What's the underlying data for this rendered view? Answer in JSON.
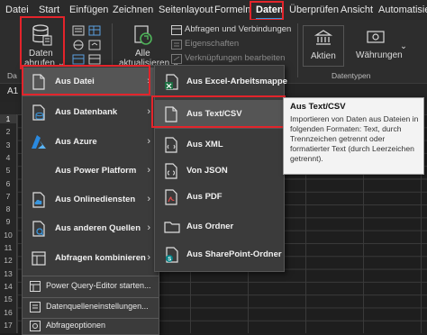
{
  "menubar": {
    "tabs": [
      "Datei",
      "Start",
      "Einfügen",
      "Zeichnen",
      "Seitenlayout",
      "Formeln",
      "Daten",
      "Überprüfen",
      "Ansicht",
      "Automatisie"
    ],
    "active_tab": "Daten"
  },
  "ribbon": {
    "get_data": {
      "line1": "Daten",
      "line2": "abrufen ⌄"
    },
    "refresh": {
      "line1": "Alle",
      "line2": "aktualisieren ⌄"
    },
    "queries_connections": "Abfragen und Verbindungen",
    "properties": "Eigenschaften",
    "edit_links": "Verknüpfungen bearbeiten",
    "stocks": "Aktien",
    "currencies": "Währungen",
    "group_datatypes": "Datentypen",
    "group_left_cut": "Da"
  },
  "formula_bar": {
    "name_box": "A1"
  },
  "rows": [
    "1",
    "2",
    "3",
    "4",
    "5",
    "6",
    "7",
    "8",
    "9",
    "10",
    "11",
    "12",
    "13",
    "14",
    "15",
    "16",
    "17"
  ],
  "menu_get_data": {
    "items": [
      {
        "label": "Aus Datei",
        "icon": "file-icon",
        "submenu": true
      },
      {
        "label": "Aus Datenbank",
        "icon": "database-icon",
        "submenu": true
      },
      {
        "label": "Aus Azure",
        "icon": "azure-icon",
        "submenu": true
      },
      {
        "label": "Aus Power Platform",
        "icon": "",
        "submenu": true
      },
      {
        "label": "Aus Onlinediensten",
        "icon": "cloud-icon",
        "submenu": true
      },
      {
        "label": "Aus anderen Quellen",
        "icon": "other-sources-icon",
        "submenu": true
      },
      {
        "label": "Abfragen kombinieren",
        "icon": "combine-icon",
        "submenu": true
      }
    ],
    "commands": [
      {
        "label": "Power Query-Editor starten...",
        "icon": "power-query-icon"
      },
      {
        "label": "Datenquelleneinstellungen...",
        "icon": "data-source-settings-icon"
      },
      {
        "label": "Abfrageoptionen",
        "icon": "query-options-icon"
      }
    ]
  },
  "menu_from_file": {
    "items": [
      {
        "label": "Aus Excel-Arbeitsmappe",
        "icon": "excel-workbook-icon"
      },
      {
        "label": "Aus Text/CSV",
        "icon": "text-csv-icon"
      },
      {
        "label": "Aus XML",
        "icon": "xml-icon"
      },
      {
        "label": "Von JSON",
        "icon": "json-icon"
      },
      {
        "label": "Aus PDF",
        "icon": "pdf-icon"
      },
      {
        "label": "Aus Ordner",
        "icon": "folder-icon"
      },
      {
        "label": "Aus SharePoint-Ordner",
        "icon": "sharepoint-folder-icon"
      }
    ]
  },
  "tooltip": {
    "title": "Aus Text/CSV",
    "body": "Importieren von Daten aus Dateien in folgenden Formaten: Text, durch Trennzeichen getrennt oder formatierter Text (durch Leerzeichen getrennt)."
  },
  "colors": {
    "highlight_red": "#e3242b",
    "accent_blue": "#3a96dd",
    "excel_green": "#1d6f42"
  }
}
